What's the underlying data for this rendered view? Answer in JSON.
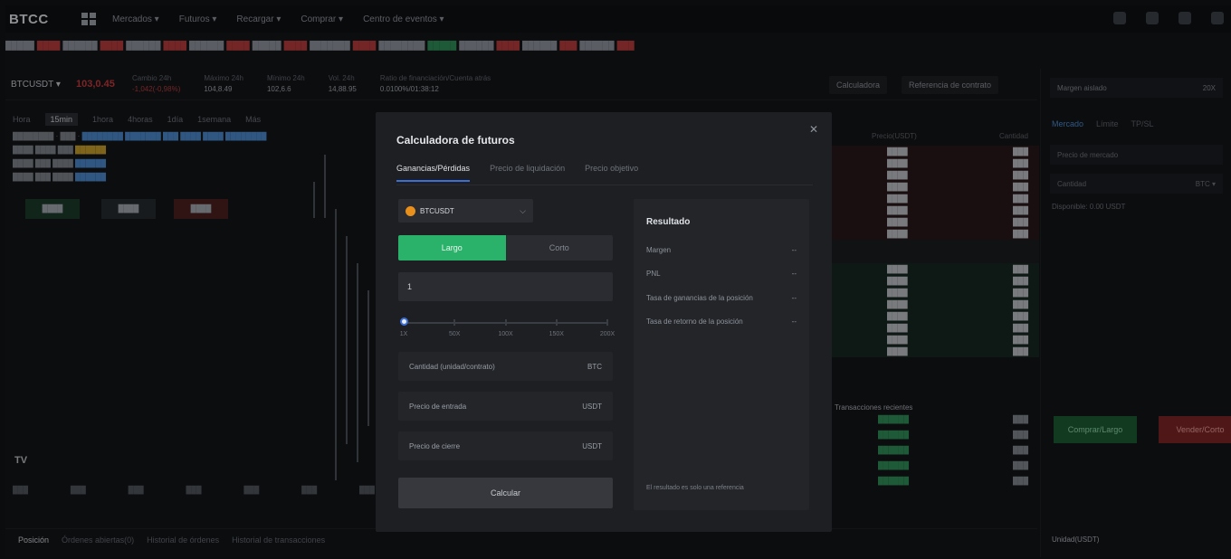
{
  "nav": {
    "logo": "BTCC",
    "items": [
      "Mercados ▾",
      "Futuros ▾",
      "Recargar ▾",
      "Comprar ▾",
      "Centro de eventos ▾"
    ]
  },
  "market": {
    "pair": "BTCUSDT ▾",
    "price": "103,0.45",
    "stats": [
      {
        "label": "Cambio 24h",
        "value": "-1,042(-0,98%)",
        "red": true
      },
      {
        "label": "Máximo 24h",
        "value": "104,8.49"
      },
      {
        "label": "Mínimo 24h",
        "value": "102,6.6"
      },
      {
        "label": "Vol. 24h",
        "value": "14,88.95"
      },
      {
        "label": "Ratio de financiación/Cuenta atrás",
        "value": "0.0100%/01:38:12"
      }
    ],
    "btn_calc": "Calculadora",
    "btn_guide": "Referencia de contrato"
  },
  "chart": {
    "tabs": [
      "Hora",
      "15min",
      "1hora",
      "4horas",
      "1día",
      "1semana",
      "Más"
    ],
    "tv": "TV"
  },
  "bottombar": {
    "items": [
      "Posición",
      "Órdenes abiertas(0)",
      "Historial de órdenes",
      "Historial de transacciones"
    ]
  },
  "orderbook": {
    "head": [
      "Precio(USDT)",
      "Cantidad"
    ],
    "trades_title": "Transacciones recientes"
  },
  "order": {
    "mode": "Margen aislado",
    "mode_value": "20X",
    "tabs": [
      "Mercado",
      "Límite",
      "TP/SL"
    ],
    "price_box": "Precio de mercado",
    "amount_box": "Cantidad",
    "amount_unit": "BTC ▾",
    "avail": "Disponible: 0.00 USDT",
    "buy": "Comprar/Largo",
    "sell": "Vender/Corto",
    "footer": "Unidad(USDT)"
  },
  "modal": {
    "title": "Calculadora de futuros",
    "tabs": [
      "Ganancias/Pérdidas",
      "Precio de liquidación",
      "Precio objetivo"
    ],
    "symbol": "BTCUSDT",
    "long_label": "Largo",
    "short_label": "Corto",
    "leverage_value": "1",
    "slider_labels": [
      "1X",
      "50X",
      "100X",
      "150X",
      "200X"
    ],
    "slider_fraction": 0.0,
    "fields": [
      {
        "label": "Cantidad (unidad/contrato)",
        "unit": "BTC"
      },
      {
        "label": "Precio de entrada",
        "unit": "USDT"
      },
      {
        "label": "Precio de cierre",
        "unit": "USDT"
      }
    ],
    "calc_button": "Calcular",
    "result": {
      "title": "Resultado",
      "rows": [
        {
          "label": "Margen",
          "value": "--"
        },
        {
          "label": "PNL",
          "value": "--"
        },
        {
          "label": "Tasa de ganancias de la posición",
          "value": "--"
        },
        {
          "label": "Tasa de retorno de la posición",
          "value": "--"
        }
      ],
      "note": "El resultado es solo una referencia"
    }
  }
}
